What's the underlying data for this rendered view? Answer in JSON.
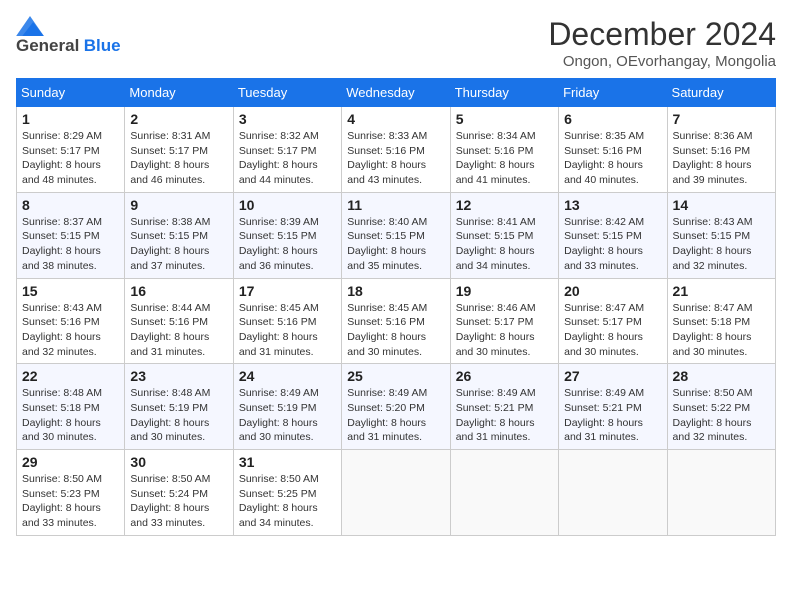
{
  "logo": {
    "general": "General",
    "blue": "Blue"
  },
  "title": "December 2024",
  "subtitle": "Ongon, OEvorhangay, Mongolia",
  "weekdays": [
    "Sunday",
    "Monday",
    "Tuesday",
    "Wednesday",
    "Thursday",
    "Friday",
    "Saturday"
  ],
  "weeks": [
    [
      {
        "day": "1",
        "sunrise": "Sunrise: 8:29 AM",
        "sunset": "Sunset: 5:17 PM",
        "daylight": "Daylight: 8 hours and 48 minutes."
      },
      {
        "day": "2",
        "sunrise": "Sunrise: 8:31 AM",
        "sunset": "Sunset: 5:17 PM",
        "daylight": "Daylight: 8 hours and 46 minutes."
      },
      {
        "day": "3",
        "sunrise": "Sunrise: 8:32 AM",
        "sunset": "Sunset: 5:17 PM",
        "daylight": "Daylight: 8 hours and 44 minutes."
      },
      {
        "day": "4",
        "sunrise": "Sunrise: 8:33 AM",
        "sunset": "Sunset: 5:16 PM",
        "daylight": "Daylight: 8 hours and 43 minutes."
      },
      {
        "day": "5",
        "sunrise": "Sunrise: 8:34 AM",
        "sunset": "Sunset: 5:16 PM",
        "daylight": "Daylight: 8 hours and 41 minutes."
      },
      {
        "day": "6",
        "sunrise": "Sunrise: 8:35 AM",
        "sunset": "Sunset: 5:16 PM",
        "daylight": "Daylight: 8 hours and 40 minutes."
      },
      {
        "day": "7",
        "sunrise": "Sunrise: 8:36 AM",
        "sunset": "Sunset: 5:16 PM",
        "daylight": "Daylight: 8 hours and 39 minutes."
      }
    ],
    [
      {
        "day": "8",
        "sunrise": "Sunrise: 8:37 AM",
        "sunset": "Sunset: 5:15 PM",
        "daylight": "Daylight: 8 hours and 38 minutes."
      },
      {
        "day": "9",
        "sunrise": "Sunrise: 8:38 AM",
        "sunset": "Sunset: 5:15 PM",
        "daylight": "Daylight: 8 hours and 37 minutes."
      },
      {
        "day": "10",
        "sunrise": "Sunrise: 8:39 AM",
        "sunset": "Sunset: 5:15 PM",
        "daylight": "Daylight: 8 hours and 36 minutes."
      },
      {
        "day": "11",
        "sunrise": "Sunrise: 8:40 AM",
        "sunset": "Sunset: 5:15 PM",
        "daylight": "Daylight: 8 hours and 35 minutes."
      },
      {
        "day": "12",
        "sunrise": "Sunrise: 8:41 AM",
        "sunset": "Sunset: 5:15 PM",
        "daylight": "Daylight: 8 hours and 34 minutes."
      },
      {
        "day": "13",
        "sunrise": "Sunrise: 8:42 AM",
        "sunset": "Sunset: 5:15 PM",
        "daylight": "Daylight: 8 hours and 33 minutes."
      },
      {
        "day": "14",
        "sunrise": "Sunrise: 8:43 AM",
        "sunset": "Sunset: 5:15 PM",
        "daylight": "Daylight: 8 hours and 32 minutes."
      }
    ],
    [
      {
        "day": "15",
        "sunrise": "Sunrise: 8:43 AM",
        "sunset": "Sunset: 5:16 PM",
        "daylight": "Daylight: 8 hours and 32 minutes."
      },
      {
        "day": "16",
        "sunrise": "Sunrise: 8:44 AM",
        "sunset": "Sunset: 5:16 PM",
        "daylight": "Daylight: 8 hours and 31 minutes."
      },
      {
        "day": "17",
        "sunrise": "Sunrise: 8:45 AM",
        "sunset": "Sunset: 5:16 PM",
        "daylight": "Daylight: 8 hours and 31 minutes."
      },
      {
        "day": "18",
        "sunrise": "Sunrise: 8:45 AM",
        "sunset": "Sunset: 5:16 PM",
        "daylight": "Daylight: 8 hours and 30 minutes."
      },
      {
        "day": "19",
        "sunrise": "Sunrise: 8:46 AM",
        "sunset": "Sunset: 5:17 PM",
        "daylight": "Daylight: 8 hours and 30 minutes."
      },
      {
        "day": "20",
        "sunrise": "Sunrise: 8:47 AM",
        "sunset": "Sunset: 5:17 PM",
        "daylight": "Daylight: 8 hours and 30 minutes."
      },
      {
        "day": "21",
        "sunrise": "Sunrise: 8:47 AM",
        "sunset": "Sunset: 5:18 PM",
        "daylight": "Daylight: 8 hours and 30 minutes."
      }
    ],
    [
      {
        "day": "22",
        "sunrise": "Sunrise: 8:48 AM",
        "sunset": "Sunset: 5:18 PM",
        "daylight": "Daylight: 8 hours and 30 minutes."
      },
      {
        "day": "23",
        "sunrise": "Sunrise: 8:48 AM",
        "sunset": "Sunset: 5:19 PM",
        "daylight": "Daylight: 8 hours and 30 minutes."
      },
      {
        "day": "24",
        "sunrise": "Sunrise: 8:49 AM",
        "sunset": "Sunset: 5:19 PM",
        "daylight": "Daylight: 8 hours and 30 minutes."
      },
      {
        "day": "25",
        "sunrise": "Sunrise: 8:49 AM",
        "sunset": "Sunset: 5:20 PM",
        "daylight": "Daylight: 8 hours and 31 minutes."
      },
      {
        "day": "26",
        "sunrise": "Sunrise: 8:49 AM",
        "sunset": "Sunset: 5:21 PM",
        "daylight": "Daylight: 8 hours and 31 minutes."
      },
      {
        "day": "27",
        "sunrise": "Sunrise: 8:49 AM",
        "sunset": "Sunset: 5:21 PM",
        "daylight": "Daylight: 8 hours and 31 minutes."
      },
      {
        "day": "28",
        "sunrise": "Sunrise: 8:50 AM",
        "sunset": "Sunset: 5:22 PM",
        "daylight": "Daylight: 8 hours and 32 minutes."
      }
    ],
    [
      {
        "day": "29",
        "sunrise": "Sunrise: 8:50 AM",
        "sunset": "Sunset: 5:23 PM",
        "daylight": "Daylight: 8 hours and 33 minutes."
      },
      {
        "day": "30",
        "sunrise": "Sunrise: 8:50 AM",
        "sunset": "Sunset: 5:24 PM",
        "daylight": "Daylight: 8 hours and 33 minutes."
      },
      {
        "day": "31",
        "sunrise": "Sunrise: 8:50 AM",
        "sunset": "Sunset: 5:25 PM",
        "daylight": "Daylight: 8 hours and 34 minutes."
      },
      null,
      null,
      null,
      null
    ]
  ]
}
